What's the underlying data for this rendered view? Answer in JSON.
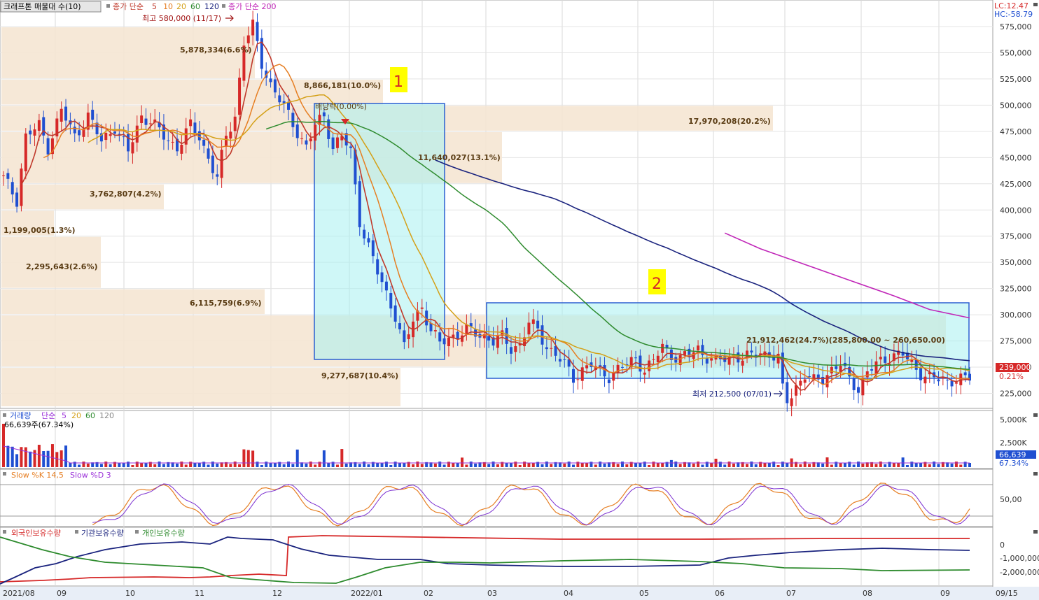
{
  "header": {
    "main_prefix": "크래프톤 매물대 수(10)",
    "main_ma_label": "종가 단순",
    "main_ma_periods": [
      {
        "label": "5",
        "color": "#c0392b"
      },
      {
        "label": "10",
        "color": "#e67e22"
      },
      {
        "label": "20",
        "color": "#d4a017"
      },
      {
        "label": "60",
        "color": "#2e8b2e"
      },
      {
        "label": "120",
        "color": "#1a237e"
      }
    ],
    "ma200_label": "종가 단순 200",
    "lc": "LC:12.47",
    "hc": "HC:-58.79",
    "volume_title": "거래량",
    "volume_ma_label": "단순",
    "volume_ma_periods": [
      {
        "label": "5",
        "color": "#9b30d9"
      },
      {
        "label": "20",
        "color": "#d4a017"
      },
      {
        "label": "60",
        "color": "#2e8b2e"
      },
      {
        "label": "120",
        "color": "#888888"
      }
    ],
    "volume_value": "66,639주(67.34%)",
    "stoch_title": "Slow %K 14,5",
    "stoch_d": "Slow %D 3",
    "holders_foreign": "외국인보유수량",
    "holders_inst": "기관보유수량",
    "holders_indiv": "개인보유수량"
  },
  "colors": {
    "up": "#d62828",
    "down": "#1f4fd1",
    "ma5": "#c0392b",
    "ma10": "#e67e22",
    "ma20": "#d4a017",
    "ma60": "#2e8b2e",
    "ma120": "#1a237e",
    "ma200": "#c026b8",
    "volume_profile": "#f5e6d3",
    "box_fill": "#a8f0f0",
    "box_border": "#2a5fd0",
    "annotation_bg": "#ffff00"
  },
  "annotations": {
    "high": "최고 580,000 (11/17)",
    "low": "최저 212,500 (07/01)",
    "box1": "1",
    "box2": "2",
    "band_label": "21,912,462(24.7%)(285,800.00 ~ 260,650.00)",
    "overlap_label": "배당락(0.00%)",
    "price_tag": "239,000",
    "price_pct": "0.21%",
    "volume_tag": "66,639",
    "volume_pct": "67.34%"
  },
  "chart_data": [
    {
      "type": "candlestick",
      "x_ticks": [
        "2021/08",
        "09",
        "10",
        "11",
        "12",
        "2022/01",
        "02",
        "03",
        "04",
        "05",
        "06",
        "07",
        "08",
        "09",
        "09/15"
      ],
      "y_ticks": [
        225000,
        250000,
        275000,
        300000,
        325000,
        350000,
        375000,
        400000,
        425000,
        450000,
        475000,
        500000,
        525000,
        550000,
        575000
      ],
      "ylim": [
        212000,
        583000
      ],
      "high": 580000,
      "low": 212500,
      "last": 239000,
      "series_close_knots": [
        [
          0,
          430000
        ],
        [
          3,
          410000
        ],
        [
          5,
          470000
        ],
        [
          8,
          480000
        ],
        [
          10,
          460000
        ],
        [
          13,
          495000
        ],
        [
          16,
          470000
        ],
        [
          19,
          490000
        ],
        [
          22,
          465000
        ],
        [
          25,
          480000
        ],
        [
          28,
          455000
        ],
        [
          31,
          490000
        ],
        [
          33,
          485000
        ],
        [
          36,
          470000
        ],
        [
          39,
          460000
        ],
        [
          42,
          480000
        ],
        [
          44,
          470000
        ],
        [
          46,
          450000
        ],
        [
          48,
          430000
        ],
        [
          50,
          470000
        ],
        [
          52,
          490000
        ],
        [
          54,
          560000
        ],
        [
          56,
          575000
        ],
        [
          58,
          540000
        ],
        [
          60,
          520000
        ],
        [
          62,
          505000
        ],
        [
          64,
          490000
        ],
        [
          66,
          475000
        ],
        [
          68,
          460000
        ],
        [
          70,
          480000
        ],
        [
          72,
          490000
        ],
        [
          74,
          460000
        ],
        [
          76,
          470000
        ],
        [
          78,
          455000
        ],
        [
          80,
          390000
        ],
        [
          82,
          365000
        ],
        [
          84,
          340000
        ],
        [
          86,
          320000
        ],
        [
          88,
          300000
        ],
        [
          90,
          268000
        ],
        [
          92,
          295000
        ],
        [
          94,
          308000
        ],
        [
          96,
          285000
        ],
        [
          98,
          272000
        ],
        [
          100,
          278000
        ],
        [
          102,
          282000
        ],
        [
          104,
          285000
        ],
        [
          106,
          282000
        ],
        [
          108,
          280000
        ],
        [
          110,
          275000
        ],
        [
          112,
          278000
        ],
        [
          114,
          268000
        ],
        [
          116,
          272000
        ],
        [
          118,
          292000
        ],
        [
          120,
          285000
        ],
        [
          122,
          270000
        ],
        [
          124,
          262000
        ],
        [
          126,
          252000
        ],
        [
          128,
          240000
        ],
        [
          130,
          248000
        ],
        [
          132,
          252000
        ],
        [
          134,
          245000
        ],
        [
          136,
          242000
        ],
        [
          138,
          248000
        ],
        [
          140,
          252000
        ],
        [
          142,
          258000
        ],
        [
          144,
          248000
        ],
        [
          146,
          255000
        ],
        [
          148,
          270000
        ],
        [
          150,
          262000
        ],
        [
          152,
          258000
        ],
        [
          154,
          262000
        ],
        [
          156,
          268000
        ],
        [
          158,
          260000
        ],
        [
          160,
          255000
        ],
        [
          162,
          258000
        ],
        [
          164,
          262000
        ],
        [
          166,
          258000
        ],
        [
          168,
          260000
        ],
        [
          170,
          265000
        ],
        [
          172,
          262000
        ],
        [
          174,
          258000
        ],
        [
          175,
          228000
        ],
        [
          176,
          218000
        ],
        [
          178,
          232000
        ],
        [
          180,
          242000
        ],
        [
          182,
          236000
        ],
        [
          184,
          240000
        ],
        [
          186,
          248000
        ],
        [
          188,
          252000
        ],
        [
          190,
          238000
        ],
        [
          192,
          230000
        ],
        [
          194,
          245000
        ],
        [
          196,
          252000
        ],
        [
          198,
          258000
        ],
        [
          200,
          262000
        ],
        [
          202,
          262000
        ],
        [
          204,
          252000
        ],
        [
          206,
          245000
        ],
        [
          208,
          240000
        ],
        [
          210,
          238000
        ],
        [
          212,
          236000
        ],
        [
          214,
          240000
        ],
        [
          216,
          238000
        ],
        [
          217,
          239000
        ]
      ],
      "ma200_knots": [
        [
          162,
          378000
        ],
        [
          170,
          363000
        ],
        [
          180,
          348000
        ],
        [
          190,
          333000
        ],
        [
          200,
          318000
        ],
        [
          208,
          305000
        ],
        [
          217,
          297000
        ]
      ]
    },
    {
      "type": "bar",
      "title": "거래량",
      "y_ticks": [
        "5,000K",
        "2,500K"
      ],
      "last_value": 66639
    },
    {
      "type": "line",
      "title": "Slow %K 14,5",
      "y_ticks": [
        "50,00"
      ]
    },
    {
      "type": "line",
      "title": "외국인보유수량",
      "y_ticks": [
        "0",
        "-1,000,000",
        "-2,000,000"
      ]
    }
  ],
  "volume_profile": [
    {
      "label": "5,878,334(6.6%)"
    },
    {
      "label": "8,866,181(10.0%)"
    },
    {
      "label": "17,970,208(20.2%)"
    },
    {
      "label": "11,640,027(13.1%)"
    },
    {
      "label": "3,762,807(4.2%)"
    },
    {
      "label": "1,199,005(1.3%)"
    },
    {
      "label": "2,295,643(2.6%)"
    },
    {
      "label": "6,115,759(6.9%)"
    },
    {
      "label": "21,912,462(24.7%)"
    },
    {
      "label": "9,277,687(10.4%)"
    }
  ]
}
